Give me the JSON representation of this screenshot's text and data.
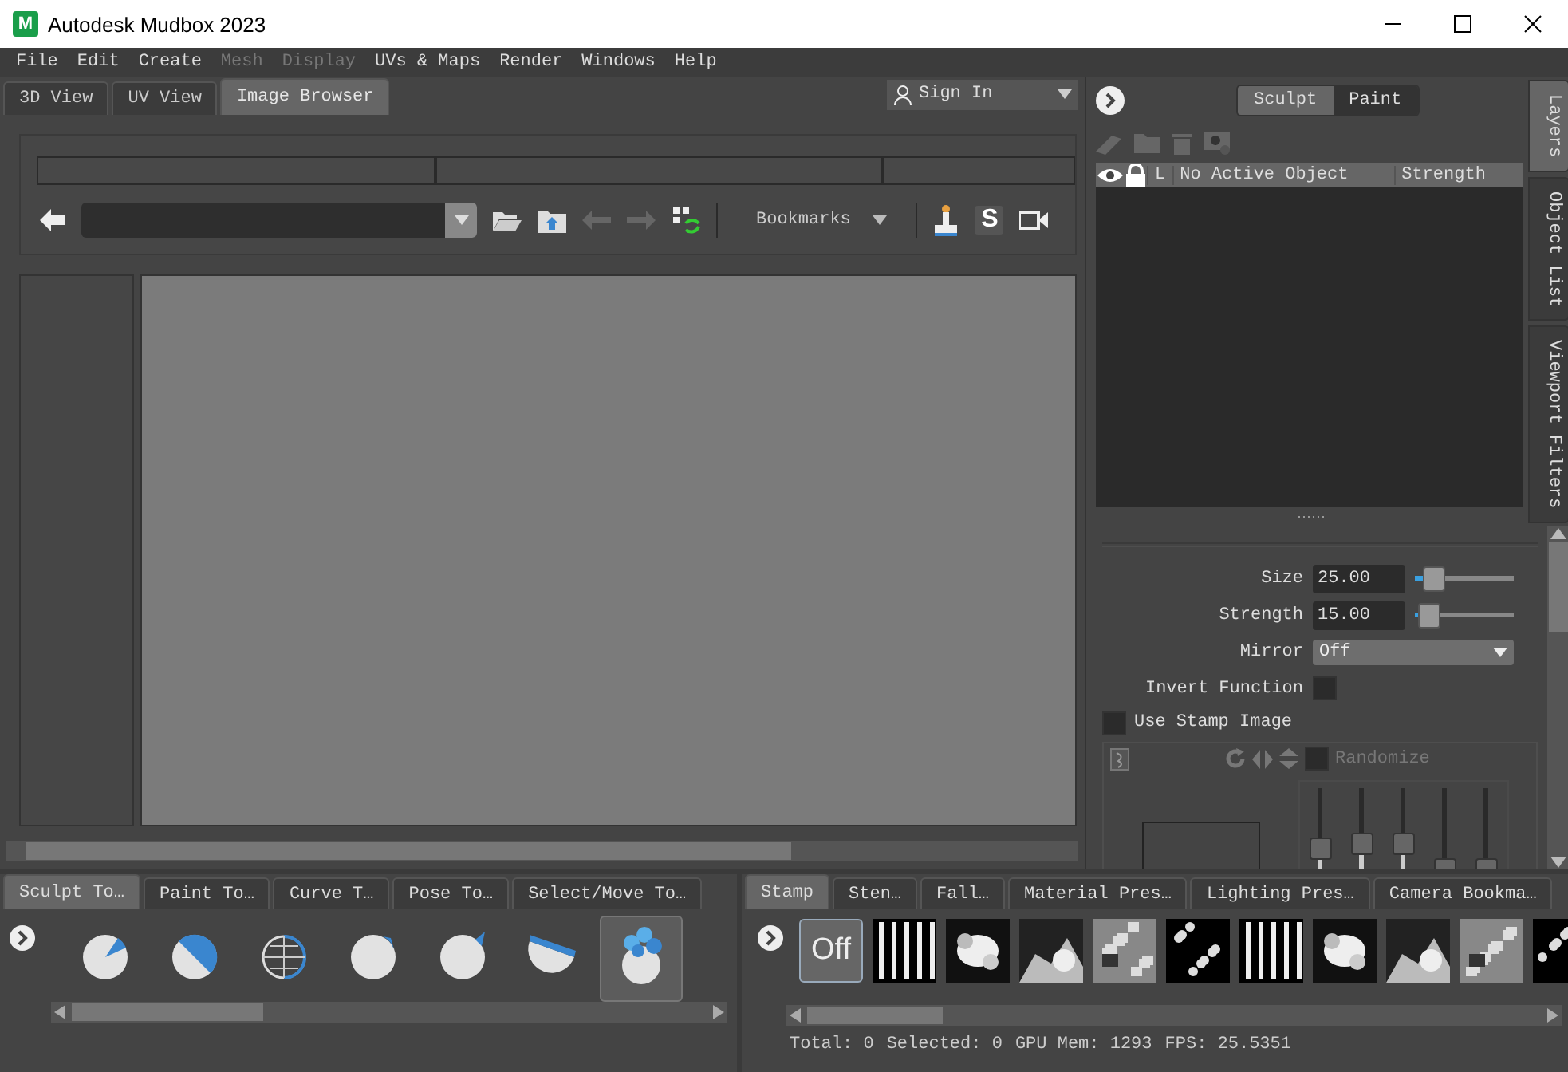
{
  "window": {
    "logo": "M",
    "title": "Autodesk Mudbox 2023"
  },
  "menu": [
    {
      "label": "File",
      "disabled": false
    },
    {
      "label": "Edit",
      "disabled": false
    },
    {
      "label": "Create",
      "disabled": false
    },
    {
      "label": "Mesh",
      "disabled": true
    },
    {
      "label": "Display",
      "disabled": true
    },
    {
      "label": "UVs & Maps",
      "disabled": false
    },
    {
      "label": "Render",
      "disabled": false
    },
    {
      "label": "Windows",
      "disabled": false
    },
    {
      "label": "Help",
      "disabled": false
    }
  ],
  "view_tabs": [
    {
      "label": "3D View",
      "selected": false
    },
    {
      "label": "UV View",
      "selected": false
    },
    {
      "label": "Image Browser",
      "selected": true
    }
  ],
  "account": {
    "label": "Sign In"
  },
  "image_browser": {
    "bookmarks": "Bookmarks",
    "stencil_key": "S"
  },
  "panel_modes": [
    {
      "label": "Sculpt",
      "selected": true
    },
    {
      "label": "Paint",
      "selected": false
    }
  ],
  "layers": {
    "columns": [
      "L",
      "No Active Object",
      "Strength"
    ]
  },
  "side_tabs": [
    {
      "label": "Layers",
      "selected": true
    },
    {
      "label": "Object List",
      "selected": false
    },
    {
      "label": "Viewport Filters",
      "selected": false
    }
  ],
  "properties": {
    "size": {
      "label": "Size",
      "value": "25.00",
      "level": 0.12
    },
    "strength": {
      "label": "Strength",
      "value": "15.00",
      "level": 0.07
    },
    "mirror": {
      "label": "Mirror",
      "value": "Off"
    },
    "invert": {
      "label": "Invert Function",
      "checked": false
    },
    "stamp_image": {
      "label": "Use Stamp Image",
      "checked": false
    },
    "randomize": {
      "label": "Randomize",
      "checked": false,
      "disabled": true
    },
    "stamp_sliders": [
      {
        "level": 0.55
      },
      {
        "level": 0.6
      },
      {
        "level": 0.6
      },
      {
        "level": 0.35
      },
      {
        "level": 0.35
      }
    ]
  },
  "tool_tabs": [
    {
      "label": "Sculpt To…",
      "selected": true
    },
    {
      "label": "Paint To…",
      "selected": false
    },
    {
      "label": "Curve T…",
      "selected": false
    },
    {
      "label": "Pose To…",
      "selected": false
    },
    {
      "label": "Select/Move To…",
      "selected": false
    }
  ],
  "tools": [
    {
      "kind": "sculpt",
      "selected": false
    },
    {
      "kind": "smooth",
      "selected": false
    },
    {
      "kind": "relax",
      "selected": false
    },
    {
      "kind": "grab",
      "selected": false
    },
    {
      "kind": "pinch",
      "selected": false
    },
    {
      "kind": "flatten",
      "selected": false
    },
    {
      "kind": "foamy",
      "selected": true
    }
  ],
  "tray_tabs": [
    {
      "label": "Stamp",
      "selected": true
    },
    {
      "label": "Sten…",
      "selected": false
    },
    {
      "label": "Fall…",
      "selected": false
    },
    {
      "label": "Material Pres…",
      "selected": false
    },
    {
      "label": "Lighting Pres…",
      "selected": false
    },
    {
      "label": "Camera Bookma…",
      "selected": false
    }
  ],
  "stamps": [
    {
      "kind": "off",
      "label": "Off",
      "selected": true
    },
    {
      "kind": "picture",
      "selected": false
    },
    {
      "kind": "picture",
      "selected": false
    },
    {
      "kind": "picture",
      "selected": false
    },
    {
      "kind": "picture",
      "selected": false
    },
    {
      "kind": "picture",
      "selected": false
    },
    {
      "kind": "picture",
      "selected": false
    },
    {
      "kind": "picture",
      "selected": false
    },
    {
      "kind": "picture",
      "selected": false
    },
    {
      "kind": "picture",
      "selected": false
    },
    {
      "kind": "picture",
      "selected": false
    }
  ],
  "status": [
    "Total: 0",
    "Selected: 0",
    "GPU Mem: 1293",
    "FPS: 25.5351"
  ]
}
